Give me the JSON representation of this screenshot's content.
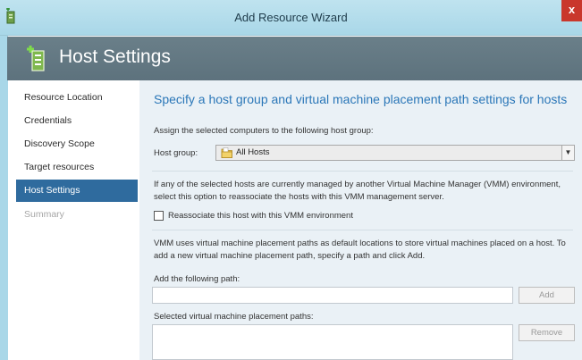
{
  "window": {
    "title": "Add Resource Wizard",
    "close_glyph": "x"
  },
  "banner": {
    "title": "Host Settings",
    "icon": "server-add-icon"
  },
  "nav": {
    "items": [
      {
        "label": "Resource Location",
        "state": "normal"
      },
      {
        "label": "Credentials",
        "state": "normal"
      },
      {
        "label": "Discovery Scope",
        "state": "normal"
      },
      {
        "label": "Target resources",
        "state": "normal"
      },
      {
        "label": "Host Settings",
        "state": "active"
      },
      {
        "label": "Summary",
        "state": "disabled"
      }
    ]
  },
  "main": {
    "heading": "Specify a host group and virtual machine placement path settings for hosts",
    "assign_text": "Assign the selected computers to the following host group:",
    "host_group_label": "Host group:",
    "host_group_value": "All Hosts",
    "reassociate_info": "If any of the selected hosts are currently managed by another Virtual Machine Manager (VMM) environment, select this option to reassociate the hosts with this VMM management server.",
    "reassociate_checkbox_label": "Reassociate this host with this VMM environment",
    "reassociate_checked": false,
    "placement_info": "VMM uses virtual machine placement paths as default locations to store virtual machines placed on a host. To add a new virtual machine placement path, specify a path and click Add.",
    "add_path_label": "Add the following path:",
    "add_path_value": "",
    "add_button": "Add",
    "selected_paths_label": "Selected virtual machine placement paths:",
    "remove_button": "Remove"
  },
  "colors": {
    "title_bar": "#a9d7e8",
    "banner": "#627883",
    "nav_active": "#2f6b9e",
    "heading": "#2b77b8",
    "content_bg": "#eaf1f6"
  }
}
